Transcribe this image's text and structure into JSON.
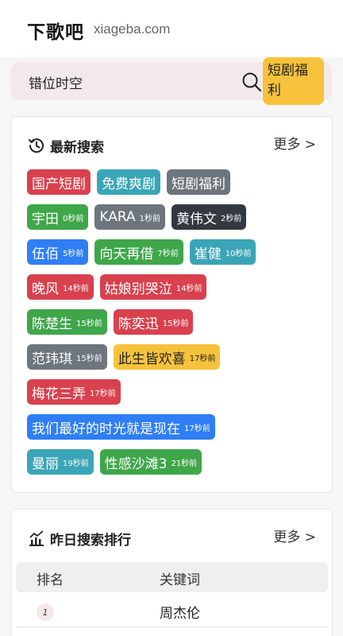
{
  "header": {
    "logo": "下歌吧",
    "domain": "xiageba.com"
  },
  "search": {
    "value": "错位时空",
    "button_label": "短剧福利"
  },
  "latest": {
    "title": "最新搜索",
    "more": "更多 >",
    "rows": [
      [
        {
          "label": "国产短剧",
          "time": "",
          "color": "#d9414e"
        },
        {
          "label": "免费爽剧",
          "time": "",
          "color": "#3aa5b7"
        },
        {
          "label": "短剧福利",
          "time": "",
          "color": "#6d757d"
        }
      ],
      [
        {
          "label": "宇田",
          "time": "0秒前",
          "color": "#3fa64a"
        },
        {
          "label": "KARA",
          "time": "1秒前",
          "color": "#6d757d"
        },
        {
          "label": "黄伟文",
          "time": "2秒前",
          "color": "#33393f"
        }
      ],
      [
        {
          "label": "伍佰",
          "time": "5秒前",
          "color": "#2f7ef5"
        },
        {
          "label": "向天再借",
          "time": "7秒前",
          "color": "#3fa64a"
        },
        {
          "label": "崔健",
          "time": "10秒前",
          "color": "#3aa5b7"
        }
      ],
      [
        {
          "label": "晚风",
          "time": "14秒前",
          "color": "#d9414e"
        },
        {
          "label": "姑娘别哭泣",
          "time": "14秒前",
          "color": "#d9414e"
        }
      ],
      [
        {
          "label": "陈楚生",
          "time": "15秒前",
          "color": "#3fa64a"
        },
        {
          "label": "陈奕迅",
          "time": "15秒前",
          "color": "#d9414e"
        }
      ],
      [
        {
          "label": "范玮琪",
          "time": "15秒前",
          "color": "#6d757d"
        },
        {
          "label": "此生皆欢喜",
          "time": "17秒前",
          "color": "#f7c23b"
        }
      ],
      [
        {
          "label": "梅花三弄",
          "time": "17秒前",
          "color": "#d9414e"
        }
      ],
      [
        {
          "label": "我们最好的时光就是现在",
          "time": "17秒前",
          "color": "#2f7ef5"
        }
      ],
      [
        {
          "label": "曼丽",
          "time": "19秒前",
          "color": "#3aa5b7"
        },
        {
          "label": "性感沙滩3",
          "time": "21秒前",
          "color": "#3fa64a"
        }
      ]
    ]
  },
  "ranking": {
    "title": "昨日搜索排行",
    "more": "更多 >",
    "columns": [
      "排名",
      "关键词"
    ],
    "rows": [
      {
        "rank": "1",
        "keyword": "周杰伦"
      }
    ]
  }
}
